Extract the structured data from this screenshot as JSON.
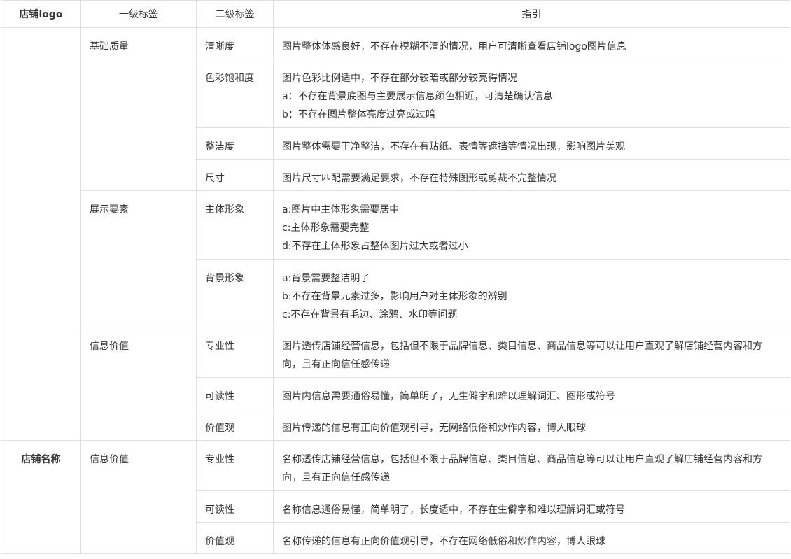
{
  "headers": [
    "店铺logo",
    "一级标签",
    "二级标签",
    "指引"
  ],
  "rows": [
    {
      "l1": "基础质量",
      "l2": "清晰度",
      "lines": [
        "图片整体体感良好，不存在模糊不清的情况，用户可清晰查看店铺logo图片信息"
      ]
    },
    {
      "l2": "色彩饱和度",
      "lines": [
        "图片色彩比例适中，不存在部分较暗或部分较亮得情况",
        "a：不存在背景底图与主要展示信息颜色相近，可清楚确认信息",
        "b：不存在图片整体亮度过亮或过暗"
      ]
    },
    {
      "l2": "整洁度",
      "lines": [
        "图片整体需要干净整洁，不存在有贴纸、表情等遮挡等情况出现，影响图片美观"
      ]
    },
    {
      "l2": "尺寸",
      "lines": [
        "图片尺寸匹配需要满足要求，不存在特殊图形或剪裁不完整情况"
      ]
    },
    {
      "l1": "展示要素",
      "l2": "主体形象",
      "lines": [
        "a:图片中主体形象需要居中",
        "c:主体形象需要完整",
        "d:不存在主体形象占整体图片过大或者过小"
      ]
    },
    {
      "l2": "背景形象",
      "lines": [
        "a:背景需要整洁明了",
        "b:不存在背景元素过多，影响用户对主体形象的辨别",
        "c:不存在背景有毛边、涂鸦、水印等问题"
      ]
    },
    {
      "l1": "信息价值",
      "l2": "专业性",
      "lines": [
        "图片透传店铺经营信息，包括但不限于品牌信息、类目信息、商品信息等可以让用户直观了解店铺经营内容和方向，且有正向信任感传递"
      ]
    },
    {
      "l2": "可读性",
      "lines": [
        "图片内信息需要通俗易懂，简单明了，无生僻字和难以理解词汇、图形或符号"
      ]
    },
    {
      "l2": "价值观",
      "lines": [
        "图片传递的信息有正向价值观引导，无网络低俗和炒作内容，博人眼球"
      ]
    },
    {
      "cat": "店铺名称",
      "l1": "信息价值",
      "l2": "专业性",
      "lines": [
        "名称透传店铺经营信息，包括但不限于品牌信息、类目信息、商品信息等可以让用户直观了解店铺经营内容和方向，且有正向信任感传递"
      ]
    },
    {
      "l2": "可读性",
      "lines": [
        "名称信息通俗易懂，简单明了，长度适中，不存在生僻字和难以理解词汇或符号"
      ]
    },
    {
      "l2": "价值观",
      "lines": [
        "名称传递的信息有正向价值观引导，不存在网络低俗和炒作内容，博人眼球"
      ]
    }
  ]
}
